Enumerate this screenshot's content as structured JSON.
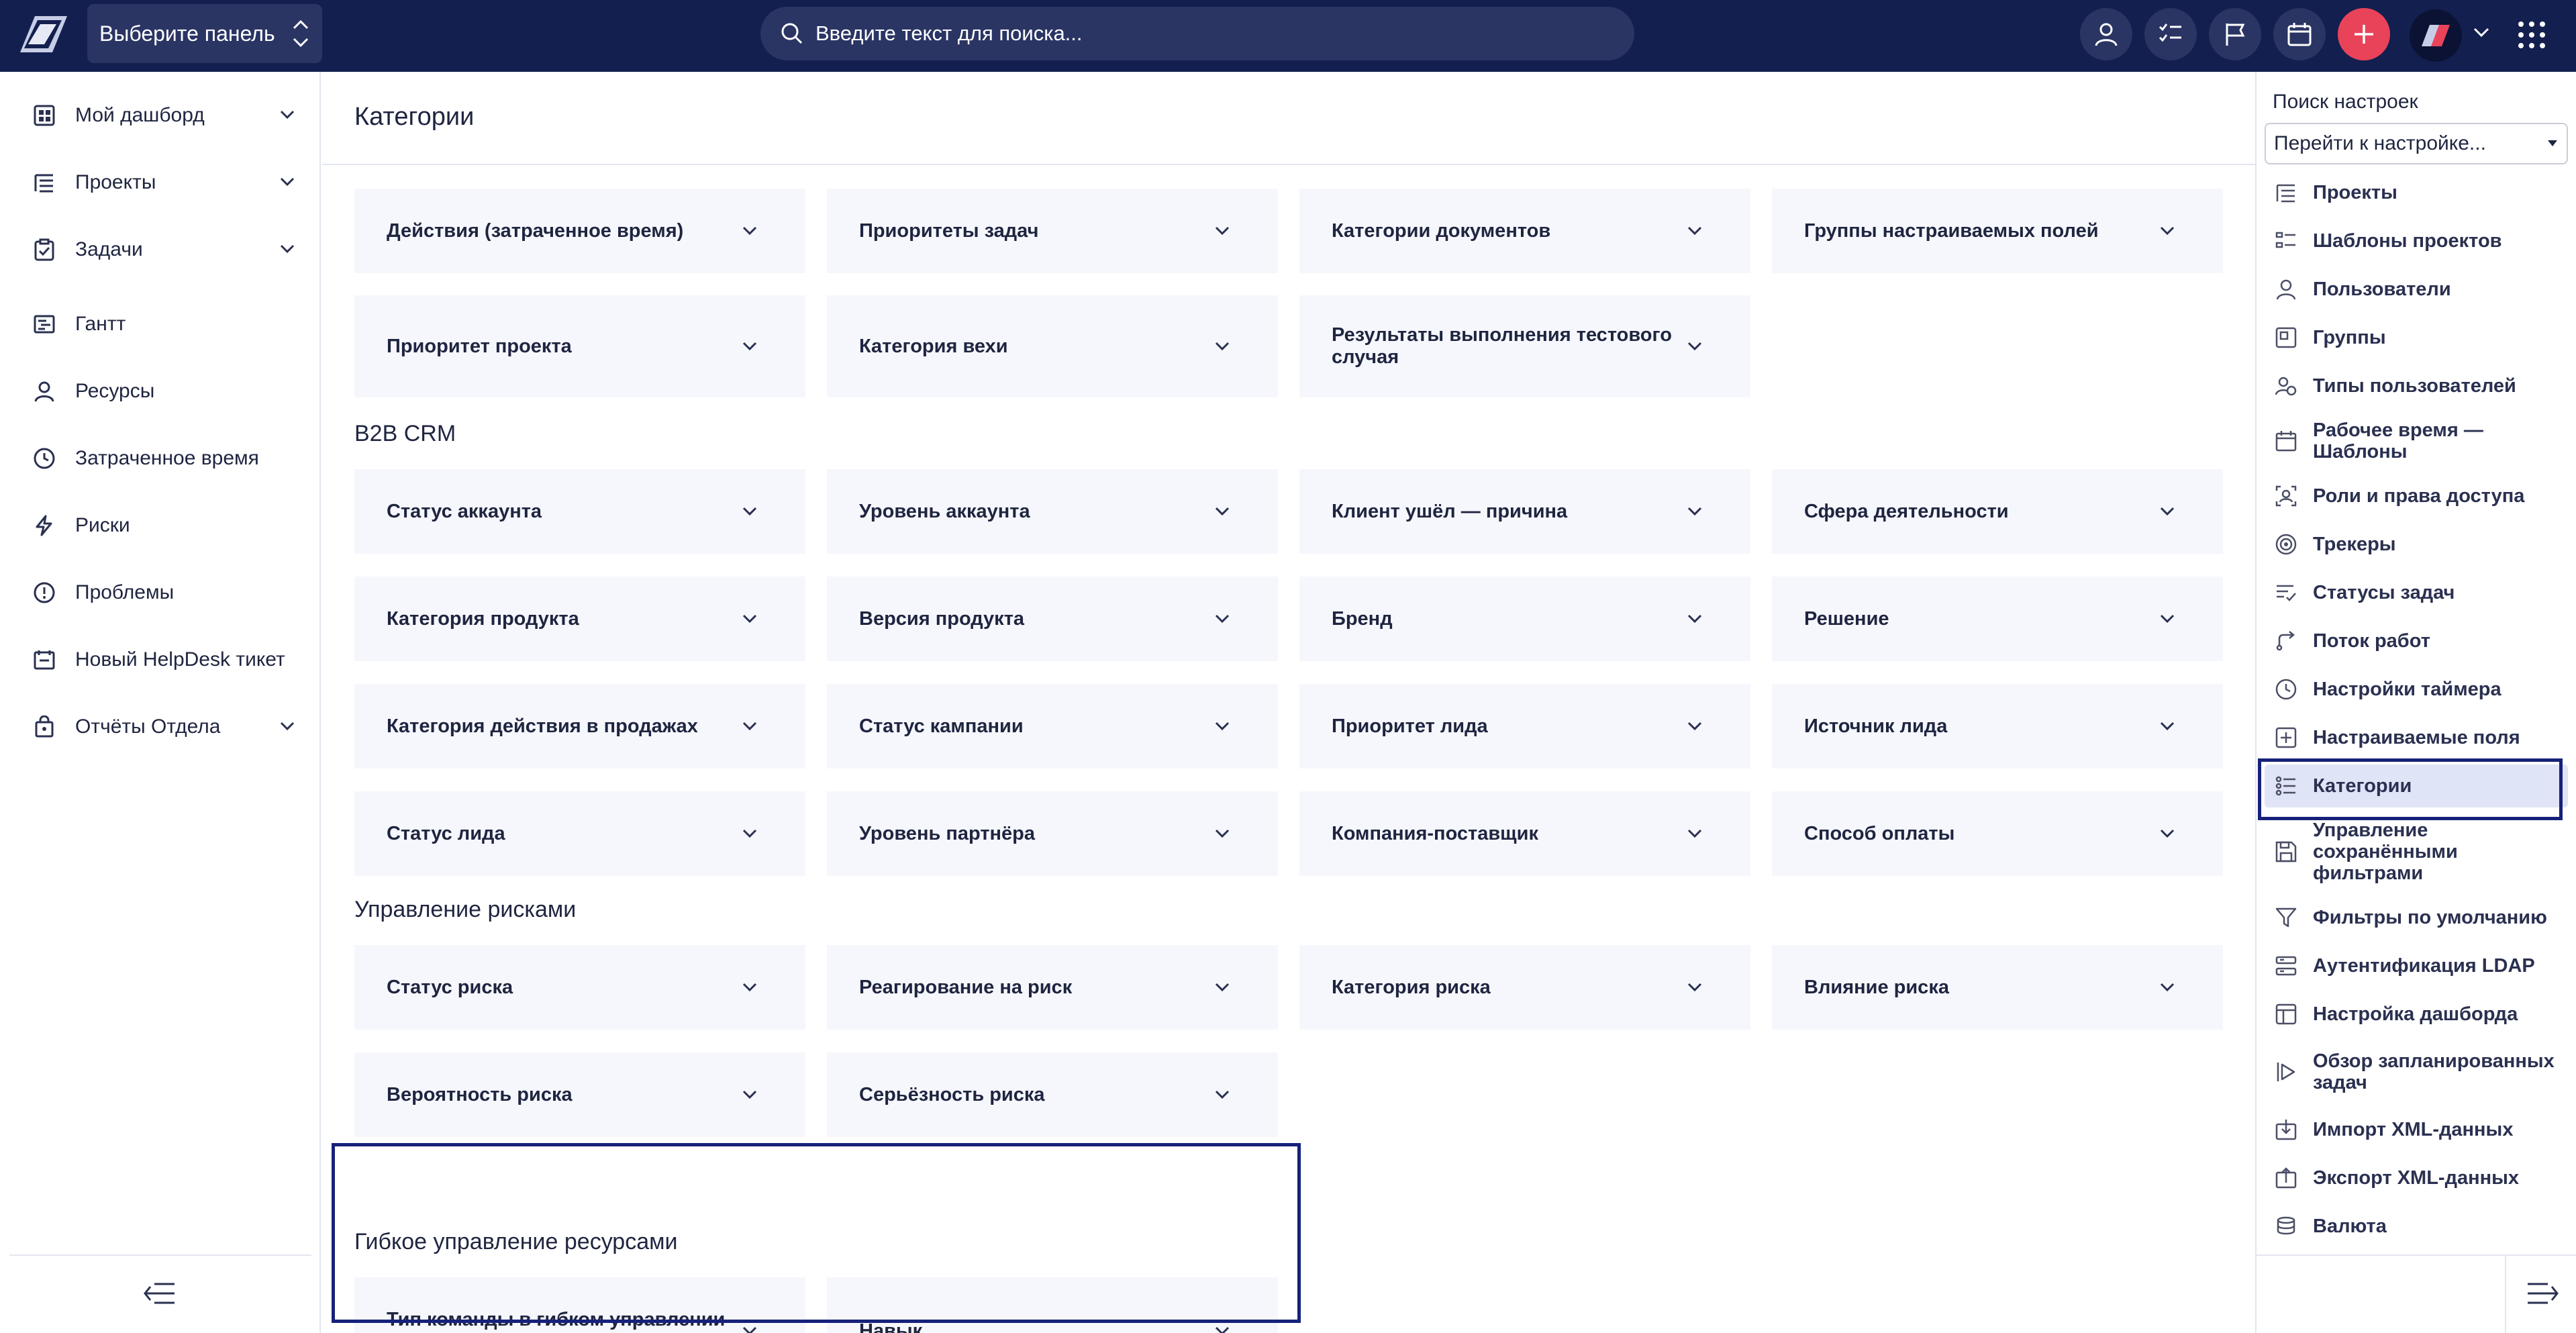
{
  "topbar": {
    "panel_select": "Выберите панель",
    "search_placeholder": "Введите текст для поиска..."
  },
  "sidebar": {
    "items": [
      {
        "label": "Мой дашборд",
        "icon": "dashboard-icon",
        "expandable": true
      },
      {
        "label": "Проекты",
        "icon": "projects-icon",
        "expandable": true
      },
      {
        "label": "Задачи",
        "icon": "tasks-icon",
        "expandable": true
      },
      {
        "label": "Гантт",
        "icon": "gantt-icon",
        "expandable": false
      },
      {
        "label": "Ресурсы",
        "icon": "user-icon",
        "expandable": false
      },
      {
        "label": "Затраченное время",
        "icon": "clock-icon",
        "expandable": false
      },
      {
        "label": "Риски",
        "icon": "lightning-icon",
        "expandable": false
      },
      {
        "label": "Проблемы",
        "icon": "alert-circle-icon",
        "expandable": false
      },
      {
        "label": "Новый HelpDesk тикет",
        "icon": "helpdesk-icon",
        "expandable": false
      },
      {
        "label": "Отчёты Отдела",
        "icon": "reports-icon",
        "expandable": true
      }
    ]
  },
  "main": {
    "title": "Категории",
    "sections": [
      {
        "title": "B2B CRM"
      },
      {
        "title": "Управление рисками"
      },
      {
        "title": "Гибкое управление ресурсами"
      }
    ],
    "cards": [
      "Действия (затраченное время)",
      "Приоритеты задач",
      "Категории документов",
      "Группы настраиваемых полей",
      "Приоритет проекта",
      "Категория вехи",
      "Результаты выполнения тестового случая",
      "Статус аккаунта",
      "Уровень аккаунта",
      "Клиент ушёл — причина",
      "Сфера деятельности",
      "Категория продукта",
      "Версия продукта",
      "Бренд",
      "Решение",
      "Категория действия в продажах",
      "Статус кампании",
      "Приоритет лида",
      "Источник лида",
      "Статус лида",
      "Уровень партнёра",
      "Компания-поставщик",
      "Способ оплаты",
      "Статус риска",
      "Реагирование на риск",
      "Категория риска",
      "Влияние риска",
      "Вероятность риска",
      "Серьёзность риска",
      "Тип команды в гибком управлении ресурсами",
      "Навык"
    ]
  },
  "settings_panel": {
    "search_label": "Поиск настроек",
    "select_value": "Перейти к настройке...",
    "items": [
      {
        "label": "Проекты",
        "icon": "projects-icon"
      },
      {
        "label": "Шаблоны проектов",
        "icon": "templates-icon"
      },
      {
        "label": "Пользователи",
        "icon": "user-icon"
      },
      {
        "label": "Группы",
        "icon": "groups-icon"
      },
      {
        "label": "Типы пользователей",
        "icon": "user-types-icon"
      },
      {
        "label": "Рабочее время — Шаблоны",
        "icon": "calendar-icon"
      },
      {
        "label": "Роли и права доступа",
        "icon": "roles-icon"
      },
      {
        "label": "Трекеры",
        "icon": "target-icon"
      },
      {
        "label": "Статусы задач",
        "icon": "statuses-icon"
      },
      {
        "label": "Поток работ",
        "icon": "workflow-icon"
      },
      {
        "label": "Настройки таймера",
        "icon": "clock-icon"
      },
      {
        "label": "Настраиваемые поля",
        "icon": "plus-box-icon"
      },
      {
        "label": "Категории",
        "icon": "categories-icon",
        "active": true
      },
      {
        "label": "Управление сохранёнными фильтрами",
        "icon": "save-icon"
      },
      {
        "label": "Фильтры по умолчанию",
        "icon": "filter-icon"
      },
      {
        "label": "Аутентификация LDAP",
        "icon": "ldap-icon"
      },
      {
        "label": "Настройка дашборда",
        "icon": "dashboard-settings-icon"
      },
      {
        "label": "Обзор запланированных задач",
        "icon": "play-icon"
      },
      {
        "label": "Импорт XML-данных",
        "icon": "import-icon"
      },
      {
        "label": "Экспорт XML-данных",
        "icon": "export-icon"
      },
      {
        "label": "Валюта",
        "icon": "currency-icon"
      }
    ]
  }
}
